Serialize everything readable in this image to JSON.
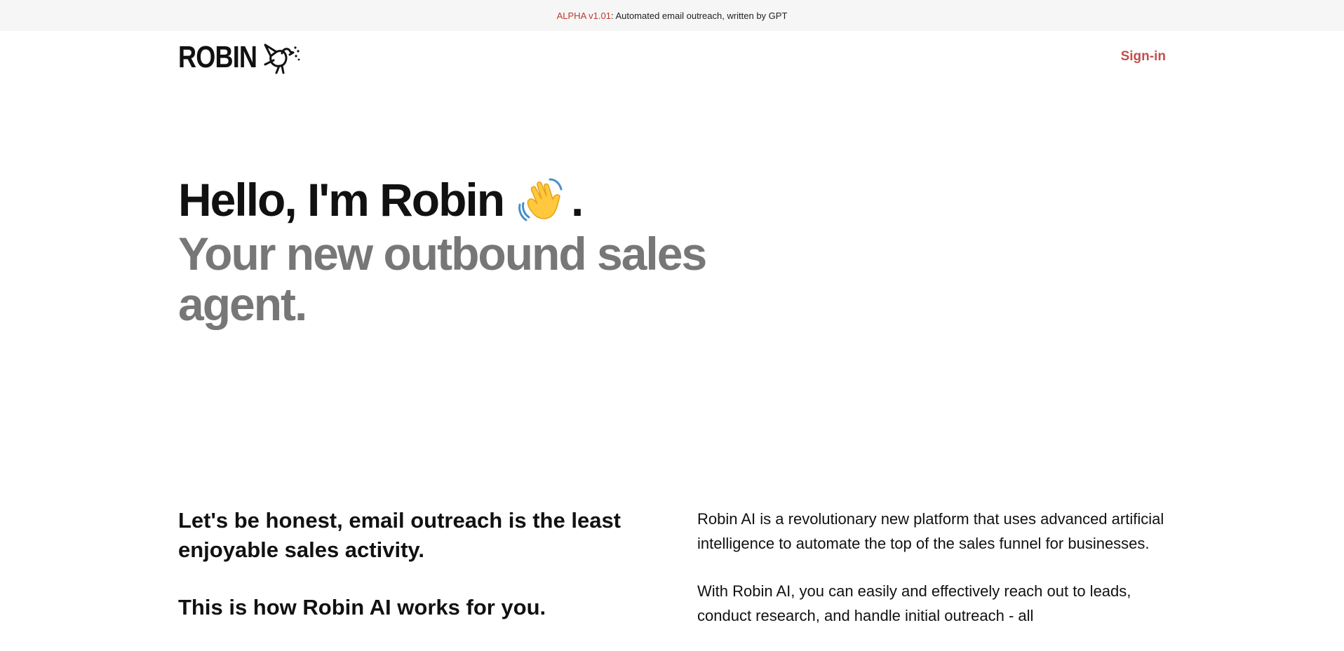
{
  "announcement": {
    "tag": "ALPHA v1.01",
    "text": ": Automated email outreach, written by GPT"
  },
  "nav": {
    "logo_text": "ROBIN",
    "signin_label": "Sign-in"
  },
  "hero": {
    "greeting": "Hello, I'm Robin",
    "greeting_end": ".",
    "wave_icon": "waving-hand-emoji",
    "tagline": "Your new outbound sales agent."
  },
  "intro": {
    "heading": "Let's be honest, email outreach is the least enjoyable sales activity.",
    "subheading": "This is how Robin AI works for you.",
    "paragraphs": [
      "Robin AI is a revolutionary new platform that uses advanced artificial intelligence to automate the top of the sales funnel for businesses.",
      "With Robin AI, you can easily and effectively reach out to leads, conduct research, and handle initial outreach - all"
    ]
  },
  "colors": {
    "accent": "#c0504d",
    "tag": "#c0392b",
    "tagline_gray": "#777777"
  }
}
